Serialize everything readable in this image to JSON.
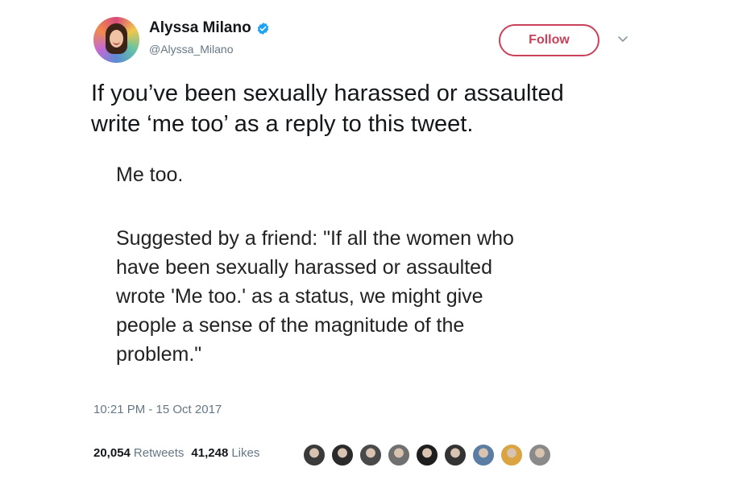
{
  "author": {
    "display_name": "Alyssa Milano",
    "handle": "@Alyssa_Milano",
    "verified": true,
    "avatar_icon": "avatar-photo"
  },
  "actions": {
    "follow_label": "Follow",
    "menu_icon": "chevron-down-icon",
    "accent_color": "#c9425a"
  },
  "tweet": {
    "text_lines": [
      "If you’ve been sexually harassed or assaulted",
      "write ‘me too’ as a reply to this tweet."
    ]
  },
  "attachment": {
    "line1": "Me too.",
    "body_lines": [
      "Suggested by a friend: \"If all the women who",
      "have been sexually harassed or assaulted",
      "wrote 'Me too.' as a status, we might give",
      "people a sense of the magnitude of the",
      "problem.\""
    ]
  },
  "meta": {
    "timestamp": "10:21 PM - 15 Oct 2017"
  },
  "stats": {
    "retweets_count": "20,054",
    "retweets_label": "Retweets",
    "likes_count": "41,248",
    "likes_label": "Likes"
  },
  "liker_avatars": [
    {
      "color": "#3a3a3a"
    },
    {
      "color": "#2b2b2b"
    },
    {
      "color": "#4a4a4a"
    },
    {
      "color": "#707070"
    },
    {
      "color": "#1e1e1e"
    },
    {
      "color": "#333333"
    },
    {
      "color": "#5c7da3"
    },
    {
      "color": "#d9a441"
    },
    {
      "color": "#8a8a8a"
    }
  ]
}
